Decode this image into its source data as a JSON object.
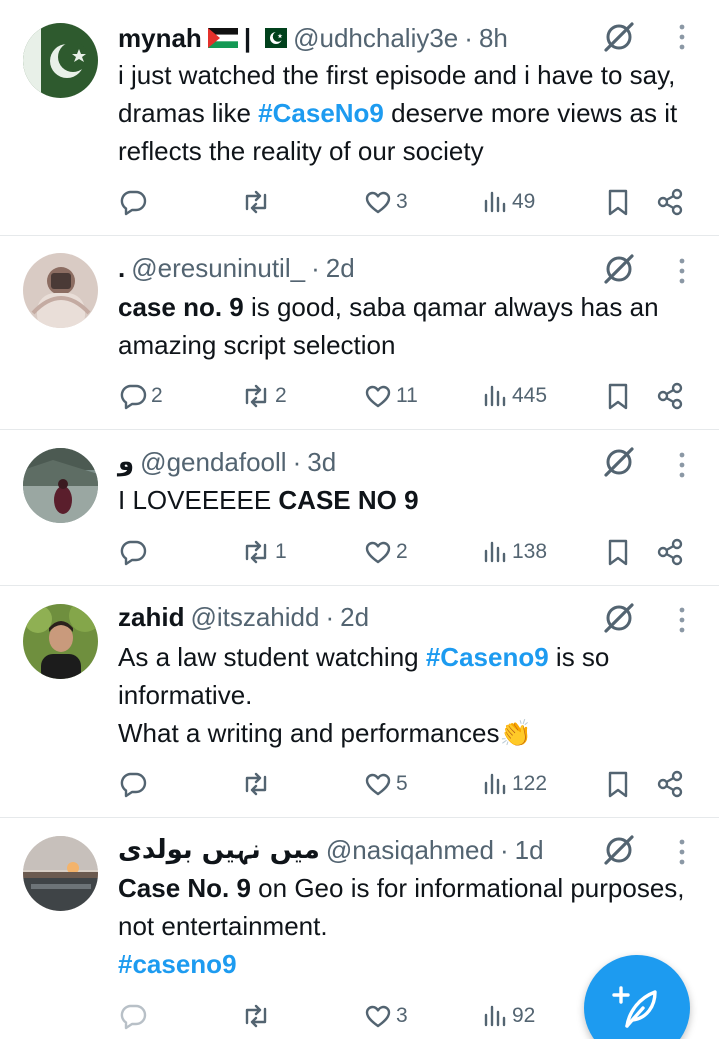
{
  "tweets": [
    {
      "name": "mynah",
      "separator": "|",
      "handle": "@udhchaliy3e",
      "dot": "·",
      "time": "8h",
      "text_parts": [
        "i just watched the first episode and i have to say, dramas like ",
        "#CaseNo9",
        " deserve more views as it reflects the reality of our society"
      ],
      "replies": "",
      "retweets": "",
      "likes": "3",
      "views": "49"
    },
    {
      "name": ".",
      "handle": "@eresuninutil_",
      "dot": "·",
      "time": "2d",
      "text_parts": [
        "case no. 9",
        " is good, saba qamar always has an amazing script selection"
      ],
      "replies": "2",
      "retweets": "2",
      "likes": "11",
      "views": "445"
    },
    {
      "name": "و",
      "handle": "@gendafooll",
      "dot": "·",
      "time": "3d",
      "text_parts": [
        "I LOVEEEEE ",
        "CASE NO 9"
      ],
      "replies": "",
      "retweets": "1",
      "likes": "2",
      "views": "138"
    },
    {
      "name": "zahid",
      "handle": "@itszahidd",
      "dot": "·",
      "time": "2d",
      "text_parts": [
        "As a law student watching ",
        "#Caseno9",
        " is so informative.",
        "What a writing and performances👏"
      ],
      "replies": "",
      "retweets": "",
      "likes": "5",
      "views": "122"
    },
    {
      "name": "میں نہیں بولدی",
      "handle": "@nasiqahmed",
      "dot": "·",
      "time": "1d",
      "text_parts": [
        "Case No. 9",
        " on Geo is for informational purposes, not entertainment.",
        "#caseno9"
      ],
      "replies": "",
      "retweets": "",
      "likes": "3",
      "views": "92"
    }
  ],
  "icons": {
    "reply": "reply-icon",
    "retweet": "retweet-icon",
    "like": "heart-icon",
    "views": "views-icon",
    "bookmark": "bookmark-icon",
    "share": "share-icon",
    "grok": "grok-icon",
    "more": "more-icon",
    "compose": "compose-post-icon"
  },
  "colors": {
    "accent": "#1d9bf0",
    "text": "#0f1419",
    "muted": "#536471",
    "divider": "#e6e9eb"
  }
}
